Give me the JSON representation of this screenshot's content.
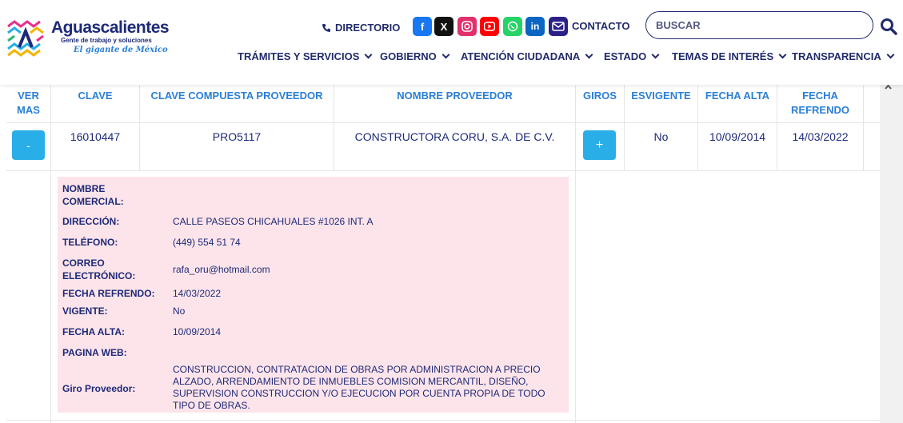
{
  "header": {
    "logo": {
      "name": "Aguascalientes",
      "tagline": "Gente de trabajo y soluciones",
      "subtitle": "El gigante de México"
    },
    "directory_label": "DIRECTORIO",
    "contact_label": "CONTACTO",
    "search_placeholder": "BUSCAR",
    "social": [
      {
        "icon": "facebook-icon",
        "glyph": "f",
        "color": "#1877f2"
      },
      {
        "icon": "x-icon",
        "glyph": "𝕏",
        "color": "#111111"
      },
      {
        "icon": "instagram-icon",
        "glyph": "◎",
        "color": "#e1306c"
      },
      {
        "icon": "youtube-icon",
        "glyph": "▶",
        "color": "#ff0000"
      },
      {
        "icon": "whatsapp-icon",
        "glyph": "✆",
        "color": "#25d366"
      },
      {
        "icon": "linkedin-icon",
        "glyph": "in",
        "color": "#0a66c2"
      },
      {
        "icon": "mail-icon",
        "glyph": "✉",
        "color": "#2b1f88"
      }
    ],
    "nav": [
      "TRÁMITES Y SERVICIOS",
      "GOBIERNO",
      "ATENCIÓN CIUDADANA",
      "ESTADO",
      "TEMAS DE INTERÉS",
      "TRANSPARENCIA"
    ]
  },
  "table": {
    "columns": [
      "VER MAS",
      "CLAVE",
      "CLAVE COMPUESTA PROVEEDOR",
      "NOMBRE PROVEEDOR",
      "GIROS",
      "ESVIGENTE",
      "FECHA ALTA",
      "FECHA REFRENDO"
    ],
    "row": {
      "toggle": "-",
      "clave": "16010447",
      "clave_compuesta": "PRO5117",
      "nombre": "CONSTRUCTORA CORU, S.A. DE C.V.",
      "giros_button": "+",
      "vigente": "No",
      "fecha_alta": "10/09/2014",
      "fecha_refrendo": "14/03/2022"
    },
    "detail": [
      {
        "label": "NOMBRE COMERCIAL:",
        "value": ""
      },
      {
        "label": "DIRECCIÓN:",
        "value": "CALLE PASEOS CHICAHUALES #1026 INT. A"
      },
      {
        "label": "TELÉFONO:",
        "value": "(449) 554 51 74"
      },
      {
        "label": "CORREO ELECTRÓNICO:",
        "value": "rafa_oru@hotmail.com"
      },
      {
        "label": "FECHA REFRENDO:",
        "value": "14/03/2022"
      },
      {
        "label": "VIGENTE:",
        "value": "No"
      },
      {
        "label": "FECHA ALTA:",
        "value": "10/09/2014"
      },
      {
        "label": "PAGINA WEB:",
        "value": ""
      },
      {
        "label": "Giro Proveedor:",
        "value": "CONSTRUCCION, CONTRATACION DE OBRAS POR ADMINISTRACION A PRECIO ALZADO, ARRENDAMIENTO DE INMUEBLES COMISION MERCANTIL, DISEÑO, SUPERVISION CONSTRUCCION Y/O EJECUCION POR CUENTA PROPIA DE TODO TIPO DE OBRAS."
      }
    ]
  },
  "colors": {
    "accent": "#29aee7",
    "header_text": "#2b7fd6",
    "brand": "#222b6b",
    "detail_bg": "#fde4ea"
  }
}
